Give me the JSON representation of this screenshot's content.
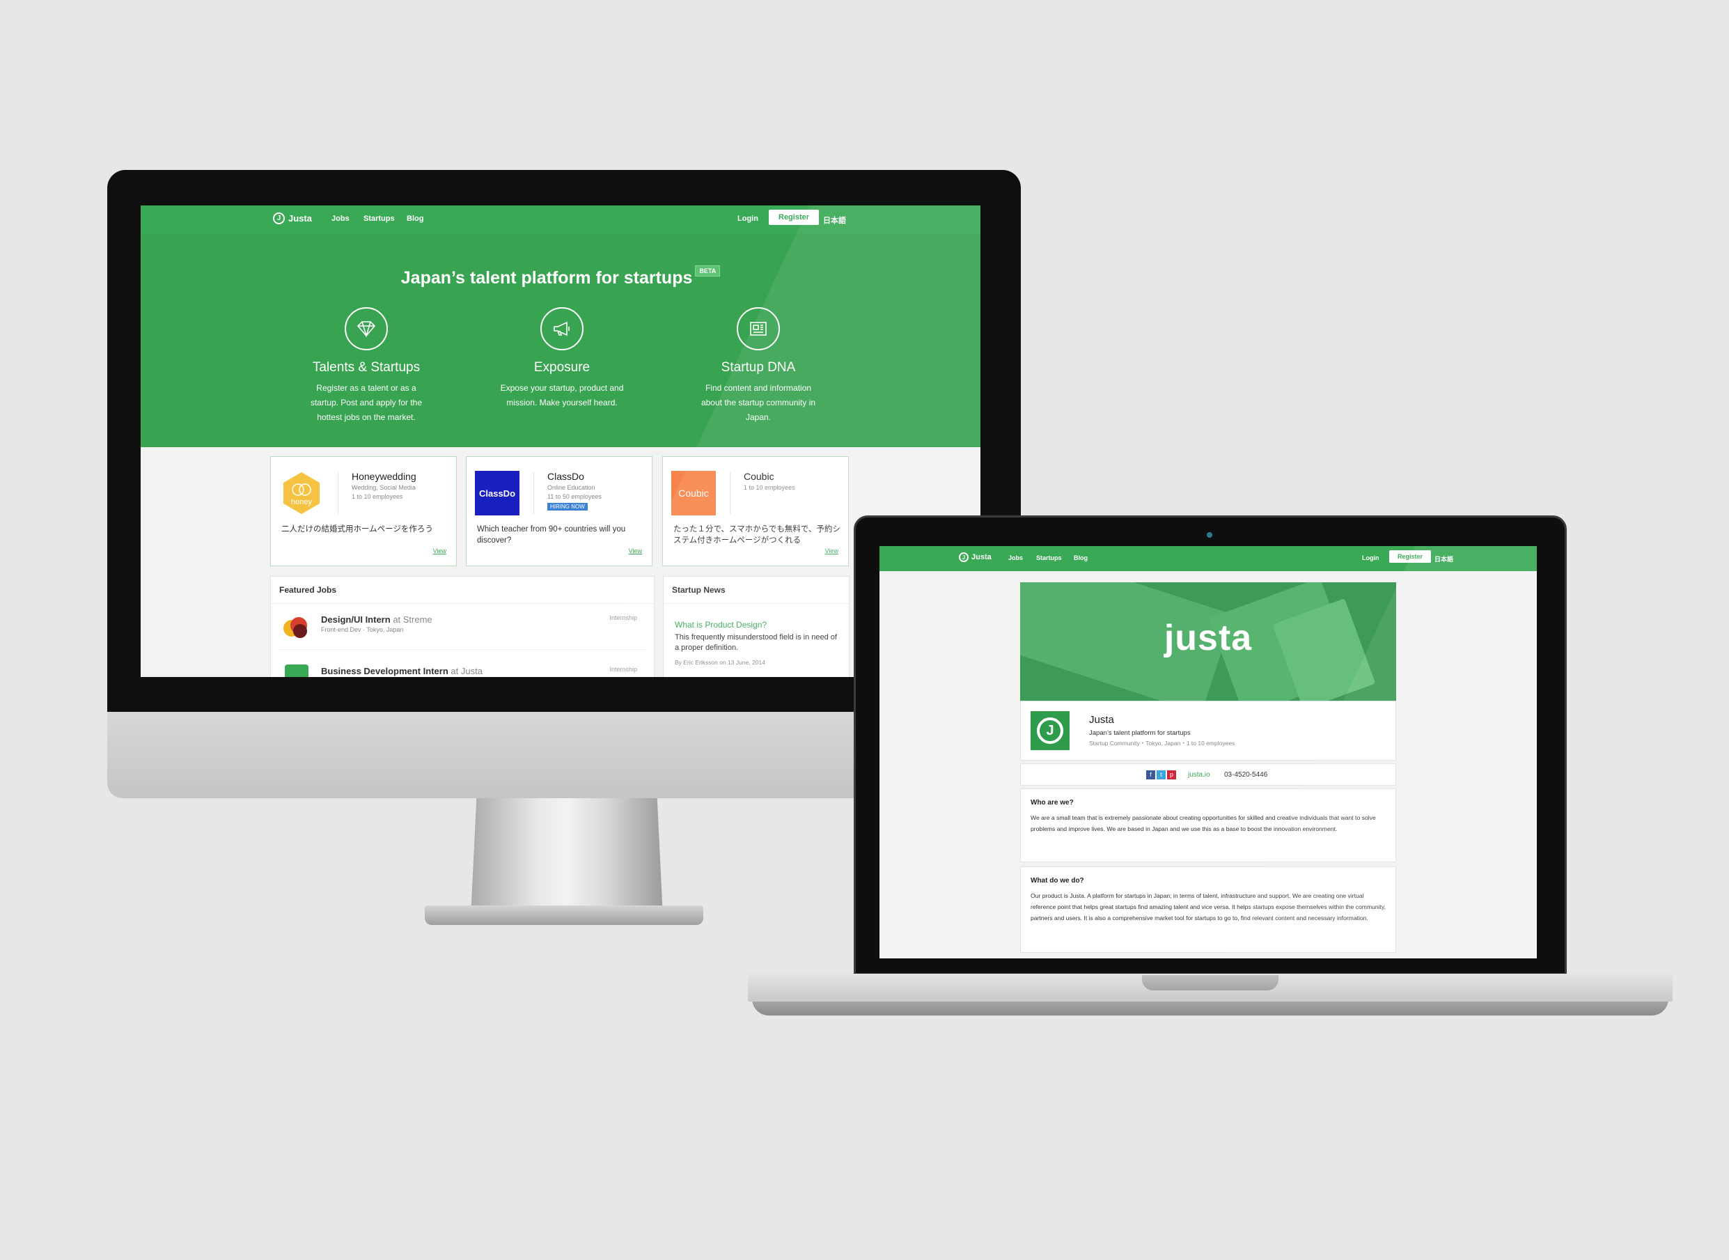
{
  "nav": {
    "logo": "Justa",
    "links": [
      "Jobs",
      "Startups",
      "Blog"
    ],
    "login": "Login",
    "register": "Register",
    "language": "日本語"
  },
  "hero": {
    "title": "Japan’s talent platform for startups",
    "badge": "BETA",
    "features": [
      {
        "icon": "diamond-icon",
        "title": "Talents & Startups",
        "desc": "Register as a talent or as a startup. Post and apply for the hottest jobs on the market."
      },
      {
        "icon": "megaphone-icon",
        "title": "Exposure",
        "desc": "Expose your startup, product and mission. Make yourself heard."
      },
      {
        "icon": "newspaper-icon",
        "title": "Startup DNA",
        "desc": "Find content and information about the startup community in Japan."
      }
    ]
  },
  "startups": [
    {
      "name": "Honeywedding",
      "category": "Wedding, Social Media",
      "size": "1 to 10 employees",
      "logo_text": "honey",
      "logo_color": "#f6c242",
      "desc": "二人だけの結婚式用ホームページを作ろう",
      "view": "View"
    },
    {
      "name": "ClassDo",
      "category": "Online Education",
      "size": "11 to 50 employees",
      "badge": "HIRING NOW",
      "logo_text": "ClassDo",
      "logo_color": "#1a1fbf",
      "desc": "Which teacher from 90+ countries will you discover?",
      "view": "View"
    },
    {
      "name": "Coubic",
      "category": "",
      "size": "1 to 10 employees",
      "logo_text": "Coubic",
      "logo_color": "#f7844a",
      "desc": "たった１分で、スマホからでも無料で、予約システム付きホームページがつくれる",
      "view": "View"
    }
  ],
  "featured_jobs": {
    "title": "Featured Jobs",
    "jobs": [
      {
        "title": "Design/UI Intern",
        "at": "at Streme",
        "sub": "Front-end Dev · Tokyo, Japan",
        "type": "Internship"
      },
      {
        "title": "Business Development Intern",
        "at": "at Justa",
        "sub": "",
        "type": "Internship"
      }
    ]
  },
  "startup_news": {
    "title": "Startup News",
    "headline": "What is Product Design?",
    "summary": "This frequently misunderstood field is in need of a proper definition.",
    "byline": "By Eric Eriksson on 13 June, 2014"
  },
  "profile": {
    "banner_word": "justa",
    "name": "Justa",
    "tagline": "Japan’s talent platform for startups",
    "meta": "Startup Community・Tokyo, Japan・1 to 10 employees",
    "website": "justa.io",
    "phone": "03-4520-5446",
    "social": [
      "f",
      "t",
      "p"
    ],
    "sections": [
      {
        "title": "Who are we?",
        "body": "We are a small team that is extremely passionate about creating opportunities for skilled and creative individuals that want to solve problems and improve lives. We are based in Japan and we use this as a base to boost the innovation environment."
      },
      {
        "title": "What do we do?",
        "body": "Our product is Justa. A platform for startups in Japan; in terms of talent, infrastructure and support. We are creating one virtual reference point that helps great startups find amazing talent and vice versa. It helps startups expose themselves within the community, partners and users. It is also a comprehensive market tool for startups to go to, find relevant content and necessary information."
      }
    ]
  },
  "colors": {
    "brand": "#3aa956",
    "hero": "#38a351",
    "accent_link": "#3aa956",
    "hiring_badge": "#3b82d6"
  }
}
